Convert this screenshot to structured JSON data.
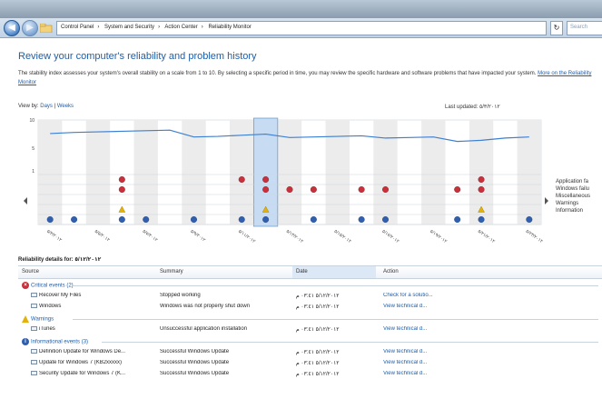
{
  "address": {
    "path": [
      "Control Panel",
      "System and Security",
      "Action Center",
      "Reliability Monitor"
    ],
    "search_placeholder": "Search"
  },
  "heading": "Review your computer's reliability and problem history",
  "description": "The stability index assesses your system's overall stability on a scale from 1 to 10. By selecting a specific period in time, you may review the specific hardware and software problems that have impacted your system.",
  "description_link": "More on the Reliability Monitor",
  "view_by": {
    "label": "View by:",
    "days": "Days",
    "weeks": "Weeks"
  },
  "last_updated": "Last updated: ٥/٣/٢٠١٢",
  "chart_data": {
    "type": "line",
    "title": "",
    "ylim": [
      1,
      10
    ],
    "y_ticks": [
      "10",
      "5",
      "1"
    ],
    "x": [
      "٥/٣/٢٠١٢",
      "٥/٤/٢٠١٢",
      "٥/٥/٢٠١٢",
      "٥/٦/٢٠١٢",
      "٥/٧/٢٠١٢",
      "٥/٨/٢٠١٢",
      "٥/٩/٢٠١٢",
      "٥/١٠/٢٠١٢",
      "٥/١١/٢٠١٢",
      "٥/١٢/٢٠١٢",
      "٥/١٣/٢٠١٢",
      "٥/١٤/٢٠١٢",
      "٥/١٥/٢٠١٢",
      "٥/١٦/٢٠١٢",
      "٥/١٧/٢٠١٢",
      "٥/١٨/٢٠١٢",
      "٥/١٩/٢٠١٢",
      "٥/٢٠/٢٠١٢",
      "٥/٢١/٢٠١٢",
      "٥/٢٢/٢٠١٢",
      "٥/٢٣/٢٠١٢"
    ],
    "stability": [
      7.6,
      7.8,
      7.9,
      8.0,
      8.1,
      8.2,
      7.0,
      7.1,
      7.3,
      7.5,
      6.9,
      7.0,
      7.1,
      7.2,
      6.8,
      6.9,
      7.0,
      6.2,
      6.4,
      6.8,
      7.0
    ],
    "selected_index": 9,
    "rows": [
      "Application failures",
      "Windows failures",
      "Miscellaneous failures",
      "Warnings",
      "Information"
    ],
    "events": {
      "Application failures": [
        3,
        8,
        9,
        18
      ],
      "Windows failures": [
        3,
        9,
        10,
        11,
        13,
        14,
        17,
        18
      ],
      "Miscellaneous failures": [],
      "Warnings": [
        3,
        9,
        18
      ],
      "Information": [
        0,
        1,
        3,
        4,
        6,
        8,
        9,
        11,
        13,
        14,
        17,
        18,
        20
      ]
    },
    "x_labels": [
      "٥/٣/٢٠١٢",
      "",
      "٥/٥/٢٠١٢",
      "",
      "٥/٧/٢٠١٢",
      "",
      "٥/٩/٢٠١٢",
      "",
      "٥/١١/٢٠١٢",
      "",
      "٥/١٣/٢٠١٢",
      "",
      "٥/١٥/٢٠١٢",
      "",
      "٥/١٧/٢٠١٢",
      "",
      "٥/١٩/٢٠١٢",
      "",
      "٥/٢١/٢٠١٢",
      "",
      "٥/٢٣/٢٠١٢"
    ],
    "colors": {
      "line": "#3d7fd1",
      "critical": "#c8313b",
      "warning": "#e2b10b",
      "info": "#2f5fae",
      "selected": "#c7dcf3"
    }
  },
  "legend": [
    "Application fa",
    "Windows failu",
    "Miscellaneous",
    "Warnings",
    "Information"
  ],
  "details_title": "Reliability details for: ٥/١٢/٢٠١٢",
  "table": {
    "headers": [
      "Source",
      "Summary",
      "Date",
      "Action"
    ],
    "groups": [
      {
        "label": "Critical events (2)",
        "icon": "critical-icon",
        "rows": [
          {
            "source": "Recover My Files",
            "summary": "Stopped working",
            "date": "٥/١٢/٢٠١٢ ٠٣:٤١ م",
            "action": "Check for a solutio..."
          },
          {
            "source": "Windows",
            "summary": "Windows was not properly shut down",
            "date": "٥/١٢/٢٠١٢ ٠٣:٤١ م",
            "action": "View technical d..."
          }
        ]
      },
      {
        "label": "Warnings",
        "icon": "warning-icon",
        "rows": [
          {
            "source": "iTunes",
            "summary": "Unsuccessful application installation",
            "date": "٥/١٢/٢٠١٢ ٠٣:٤١ م",
            "action": "View technical d..."
          }
        ]
      },
      {
        "label": "Informational events (3)",
        "icon": "info-icon",
        "rows": [
          {
            "source": "Definition Update for Windows De...",
            "summary": "Successful Windows Update",
            "date": "٥/١٢/٢٠١٢ ٠٣:٤١ م",
            "action": "View technical d..."
          },
          {
            "source": "Update for Windows 7 (KB2xxxxx)",
            "summary": "Successful Windows Update",
            "date": "٥/١٢/٢٠١٢ ٠٣:٤١ م",
            "action": "View technical d..."
          },
          {
            "source": "Security Update for Windows 7 (K...",
            "summary": "Successful Windows Update",
            "date": "٥/١٢/٢٠١٢ ٠٣:٤١ م",
            "action": "View technical d..."
          }
        ]
      }
    ]
  }
}
